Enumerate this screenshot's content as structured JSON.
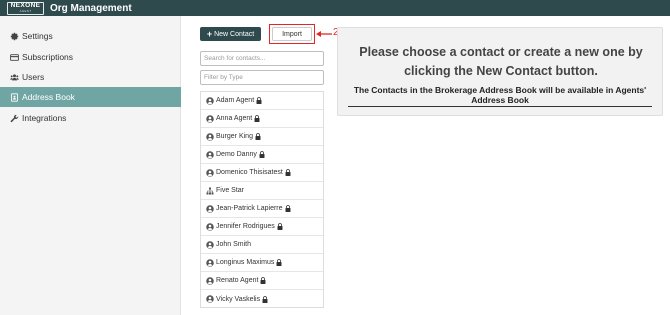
{
  "header": {
    "logo_main": "NEXONE",
    "logo_sub": "AGENT",
    "title": "Org Management"
  },
  "sidebar": {
    "items": [
      {
        "label": "Settings",
        "icon": "gear-icon"
      },
      {
        "label": "Subscriptions",
        "icon": "credit-card-icon"
      },
      {
        "label": "Users",
        "icon": "users-icon"
      },
      {
        "label": "Address Book",
        "icon": "address-book-icon",
        "active": true
      },
      {
        "label": "Integrations",
        "icon": "wrench-icon"
      }
    ]
  },
  "toolbar": {
    "new_contact_label": "New Contact",
    "import_label": "Import",
    "annotation_number": "2"
  },
  "search": {
    "placeholder": "Search for contacts...",
    "filter_placeholder": "Filter by Type"
  },
  "contacts": [
    {
      "name": "Adam Agent",
      "icon": "user-circle-icon",
      "locked": true
    },
    {
      "name": "Anna Agent",
      "icon": "user-circle-icon",
      "locked": true
    },
    {
      "name": "Burger King",
      "icon": "user-circle-icon",
      "locked": true
    },
    {
      "name": "Demo Danny",
      "icon": "user-circle-icon",
      "locked": true
    },
    {
      "name": "Domenico Thisisatest",
      "icon": "user-circle-icon",
      "locked": true
    },
    {
      "name": "Five Star",
      "icon": "org-chart-icon",
      "locked": false
    },
    {
      "name": "Jean-Patrick Lapierre",
      "icon": "user-circle-icon",
      "locked": true
    },
    {
      "name": "Jennifer Rodrigues",
      "icon": "user-circle-icon",
      "locked": true
    },
    {
      "name": "John Smith",
      "icon": "user-circle-icon",
      "locked": false
    },
    {
      "name": "Longinus Maximus",
      "icon": "user-circle-icon",
      "locked": true
    },
    {
      "name": "Renato Agent",
      "icon": "user-circle-icon",
      "locked": true
    },
    {
      "name": "Vicky Vaskelis",
      "icon": "user-circle-icon",
      "locked": true
    }
  ],
  "main": {
    "heading": "Please choose a contact or create a new one by clicking the New Contact button.",
    "note": "The Contacts in the Brokerage Address Book will be available in Agents' Address Book"
  },
  "colors": {
    "topbar": "#2e4a4d",
    "active_sidebar": "#6fa5a3",
    "annotation": "#e02828"
  }
}
